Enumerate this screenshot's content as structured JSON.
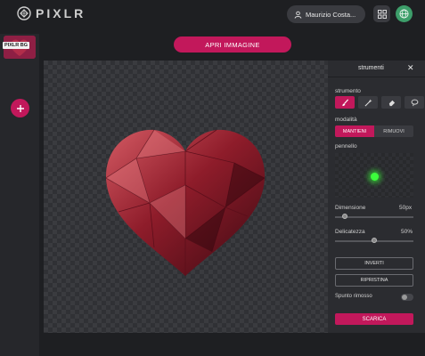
{
  "header": {
    "logo_text": "PIXLR",
    "user_name": "Maurizio Costa...",
    "accent_green": "#3d9e6a"
  },
  "toolbar": {
    "open_image_label": "APRI IMMAGINE"
  },
  "left_panel": {
    "thumbnail_label": "PIXLR BG",
    "add_label": "+"
  },
  "tools_panel": {
    "title": "strumenti",
    "close": "✕",
    "tool_label": "strumento",
    "tools": [
      "brush-icon",
      "wand-icon",
      "eraser-icon",
      "lasso-icon"
    ],
    "mode_label": "modalità",
    "modes": [
      "MANTIENI",
      "RIMUOVI"
    ],
    "active_mode": "MANTIENI",
    "brush_label": "pennello",
    "size_label": "Dimensione",
    "size_value": "50px",
    "size_fraction": 0.12,
    "softness_label": "Delicatezza",
    "softness_value": "50%",
    "softness_fraction": 0.5,
    "invert_label": "INVERTI",
    "restore_label": "RIPRISTINA",
    "removed_hint_label": "Spunto rimosso",
    "download_label": "SCARICA"
  },
  "colors": {
    "accent": "#c2185b"
  }
}
